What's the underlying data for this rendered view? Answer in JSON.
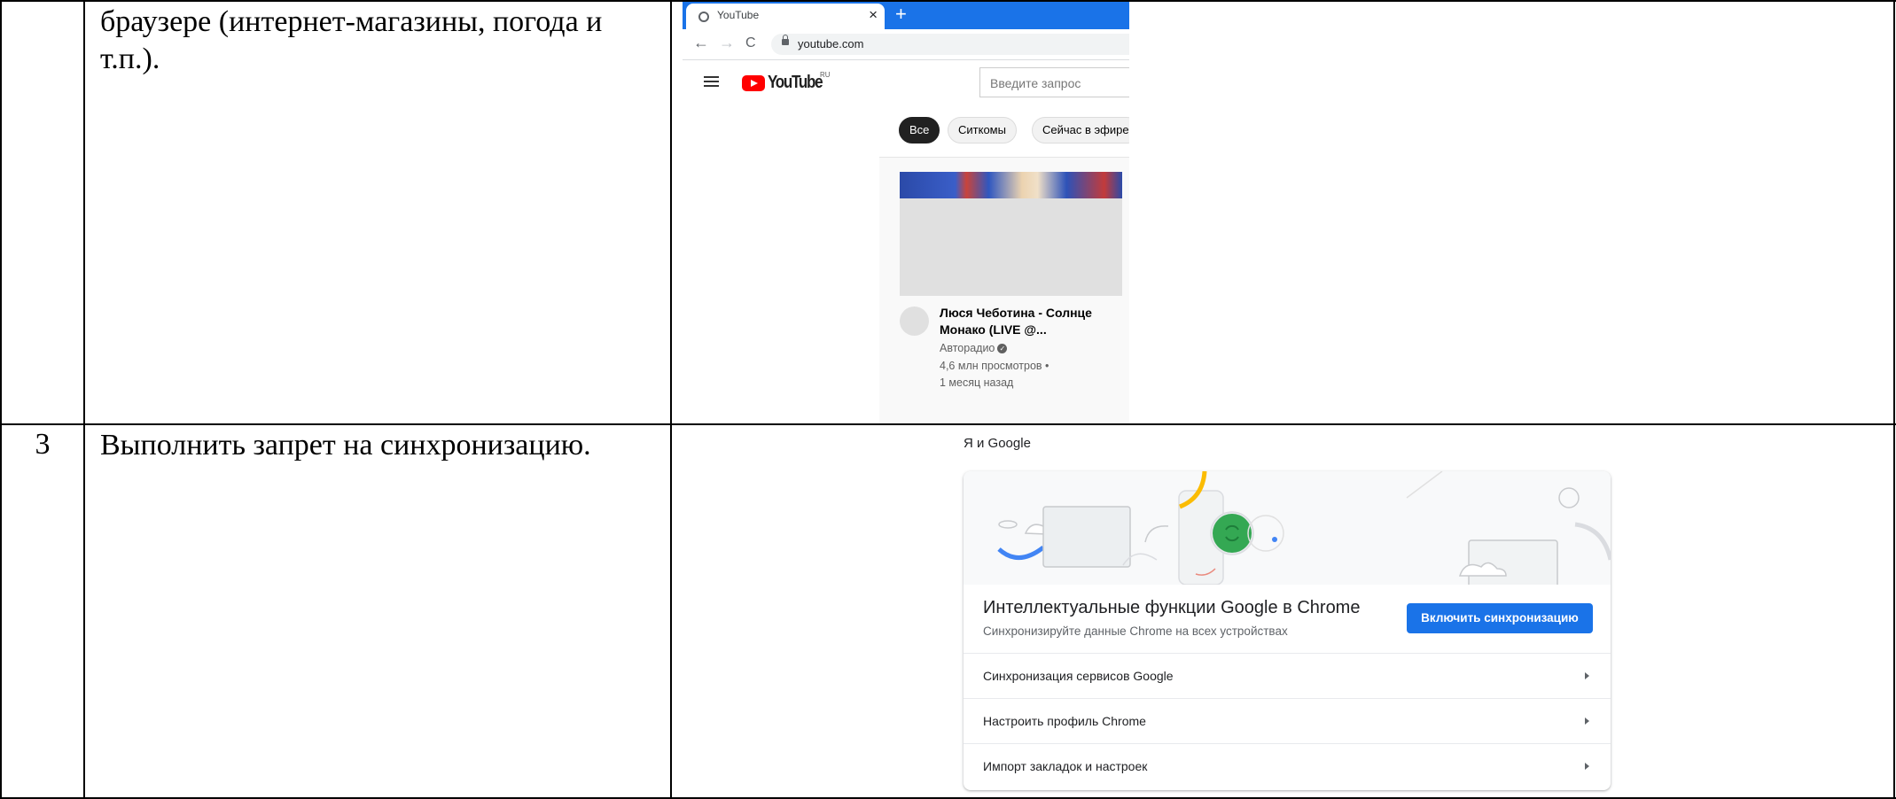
{
  "table": {
    "row_top": {
      "number": "",
      "text": "браузере (интернет-магазины, погода и т.п.)."
    },
    "row_3": {
      "number": "3",
      "text": "Выполнить запрет на синхронизацию."
    }
  },
  "youtube_screenshot": {
    "tab_title": "YouTube",
    "tab_close": "×",
    "new_tab": "+",
    "url": "youtube.com",
    "nav_back": "←",
    "nav_forward": "→",
    "nav_reload": "C",
    "logo_text": "YouTube",
    "logo_region": "RU",
    "search_placeholder": "Введите запрос",
    "chips": [
      "Все",
      "Ситкомы",
      "Сейчас в эфире"
    ],
    "active_chip": "Все",
    "video": {
      "title": "Люся Чеботина - Солнце Монако (LIVE @...",
      "channel": "Авторадио",
      "views": "4,6 млн просмотров •",
      "age": "1 месяц назад"
    }
  },
  "chrome_settings_screenshot": {
    "section_title": "Я и Google",
    "card_title": "Интеллектуальные функции Google в Chrome",
    "card_subtitle": "Синхронизируйте данные Chrome на всех устройствах",
    "sync_button": "Включить синхронизацию",
    "rows": [
      "Синхронизация сервисов Google",
      "Настроить профиль Chrome",
      "Импорт закладок и настроек"
    ],
    "colors": {
      "accent": "#1a73e8",
      "sync_circle": "#34a853",
      "decor_yellow": "#fbbc04",
      "decor_blue": "#4285f4"
    }
  }
}
